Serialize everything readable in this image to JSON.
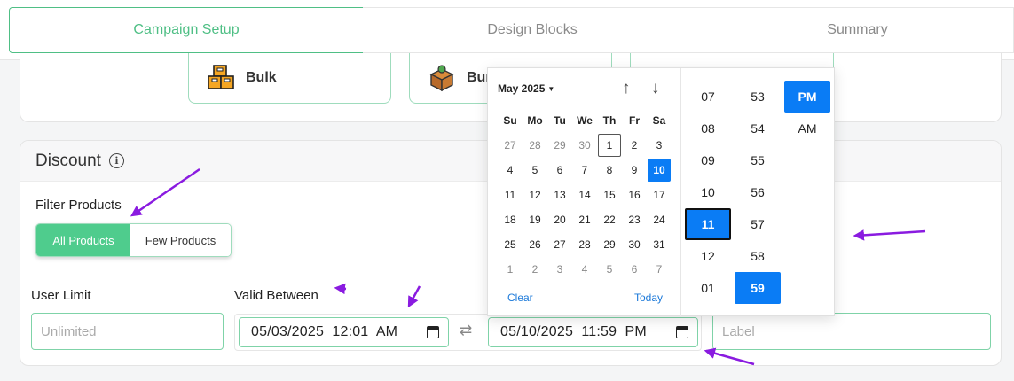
{
  "tabs": [
    {
      "label": "Campaign Setup",
      "active": true
    },
    {
      "label": "Design Blocks",
      "active": false
    },
    {
      "label": "Summary",
      "active": false
    }
  ],
  "type_cards": [
    {
      "label": "Bulk",
      "icon": "boxes-icon"
    },
    {
      "label": "Bun",
      "icon": "bundle-box-icon"
    },
    {
      "label": "",
      "icon": ""
    }
  ],
  "discount": {
    "title": "Discount",
    "filter_label": "Filter Products",
    "filter_options": [
      "All Products",
      "Few Products"
    ],
    "filter_selected": "All Products",
    "user_limit_label": "User Limit",
    "user_limit_placeholder": "Unlimited",
    "valid_label": "Valid Between",
    "start_value": "05/03/2025  12:01  AM",
    "end_value": "05/10/2025  11:59  PM",
    "label_placeholder": "Label"
  },
  "picker": {
    "month": "May 2025",
    "weekdays": [
      "Su",
      "Mo",
      "Tu",
      "We",
      "Th",
      "Fr",
      "Sa"
    ],
    "days": [
      [
        "27",
        "28",
        "29",
        "30",
        "1",
        "2",
        "3"
      ],
      [
        "4",
        "5",
        "6",
        "7",
        "8",
        "9",
        "10"
      ],
      [
        "11",
        "12",
        "13",
        "14",
        "15",
        "16",
        "17"
      ],
      [
        "18",
        "19",
        "20",
        "21",
        "22",
        "23",
        "24"
      ],
      [
        "25",
        "26",
        "27",
        "28",
        "29",
        "30",
        "31"
      ],
      [
        "1",
        "2",
        "3",
        "4",
        "5",
        "6",
        "7"
      ]
    ],
    "clear_label": "Clear",
    "today_label": "Today",
    "hours": [
      "07",
      "08",
      "09",
      "10",
      "11",
      "12",
      "01"
    ],
    "minutes": [
      "53",
      "54",
      "55",
      "56",
      "57",
      "58",
      "59"
    ],
    "ampm": [
      "PM",
      "AM"
    ],
    "selected_day": "10",
    "today_day": "1",
    "selected_hour": "11",
    "selected_minute": "59",
    "selected_ampm": "PM"
  },
  "colors": {
    "accent": "#4fcc8d",
    "selection": "#0a7cf5",
    "annotation": "#8a1be0"
  }
}
